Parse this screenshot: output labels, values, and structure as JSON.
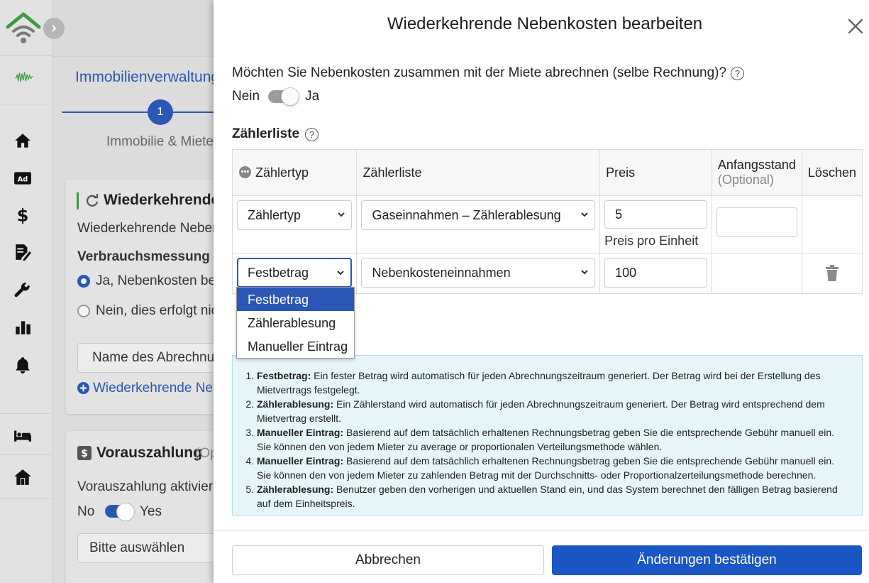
{
  "background": {
    "breadcrumb": "Immobilienverwaltung",
    "step_number": "1",
    "step_label": "Immobilie & Mieter",
    "card1": {
      "title": "Wiederkehrende",
      "subtitle": "Wiederkehrende Nebenk",
      "question": "Verbrauchsmessung erf",
      "radio_yes": "Ja, Nebenkosten berh",
      "radio_no": "Nein, dies erfolgt nic",
      "input_placeholder": "Name des Abrechnungs",
      "add_link": "Wiederkehrende Neb"
    },
    "card2": {
      "title": "Vorauszahlung",
      "title_suffix": "(Op",
      "activate_label": "Vorauszahlung aktiviere",
      "toggle_off": "No",
      "toggle_on": "Yes",
      "select_placeholder": "Bitte auswählen"
    }
  },
  "modal": {
    "title": "Wiederkehrende Nebenkosten bearbeiten",
    "question": "Möchten Sie Nebenkosten zusammen mit der Miete abrechnen (selbe Rechnung)?",
    "toggle_off": "Nein",
    "toggle_on": "Ja",
    "meter_list_heading": "Zählerliste",
    "table": {
      "headers": {
        "type": "Zählertyp",
        "list": "Zählerliste",
        "price": "Preis",
        "initial": "Anfangsstand",
        "initial_optional": "(Optional)",
        "delete": "Löschen"
      },
      "rows": [
        {
          "type": "Zählertyp",
          "list": "Gaseinnahmen – Zählerablesung",
          "price": "5",
          "price_hint": "Preis pro Einheit",
          "initial": ""
        },
        {
          "type": "Festbetrag",
          "list": "Nebenkosteneinnahmen",
          "price": "100"
        }
      ]
    },
    "dropdown_options": [
      "Festbetrag",
      "Zählerablesung",
      "Manueller Eintrag"
    ],
    "dropdown_selected": "Festbetrag",
    "info": [
      {
        "term": "Festbetrag:",
        "text": "Ein fester Betrag wird automatisch für jeden Abrechnungszeitraum generiert. Der Betrag wird bei der Erstellung des Mietvertrags festgelegt."
      },
      {
        "term": "Zählerablesung:",
        "text": "Ein Zählerstand wird automatisch für jeden Abrechnungszeitraum generiert. Der Betrag wird entsprechend dem Mietvertrag erstellt."
      },
      {
        "term": "Manueller Eintrag:",
        "text": "Basierend auf dem tatsächlich erhaltenen Rechnungsbetrag geben Sie die entsprechende Gebühr manuell ein. Sie können den von jedem Mieter zu average or proportionalen Verteilungsmethode wählen."
      },
      {
        "term": "Manueller Eintrag:",
        "text": "Basierend auf dem tatsächlich erhaltenen Rechnungsbetrag geben Sie die entsprechende Gebühr manuell ein. Sie können den von jedem Mieter zu zahlenden Betrag mit der Durchschnitts- oder Proportionalzerteilungsmethode berechnen."
      },
      {
        "term": "Zählerablesung:",
        "text": "Benutzer geben den vorherigen und aktuellen Stand ein, und das System berechnet den fälligen Betrag basierend auf dem Einheitspreis."
      }
    ],
    "cancel_label": "Abbrechen",
    "confirm_label": "Änderungen bestätigen"
  },
  "rail_icons": [
    "home-icon",
    "ad-icon",
    "dollar-icon",
    "edit-contract-icon",
    "wrench-icon",
    "bar-chart-icon",
    "bell-icon",
    "bed-icon",
    "house-icon"
  ],
  "colors": {
    "primary": "#1a56c4",
    "accent_blue": "#2a57b5",
    "info_bg": "#e5f5f8",
    "logo_green": "#3f9a3b"
  }
}
